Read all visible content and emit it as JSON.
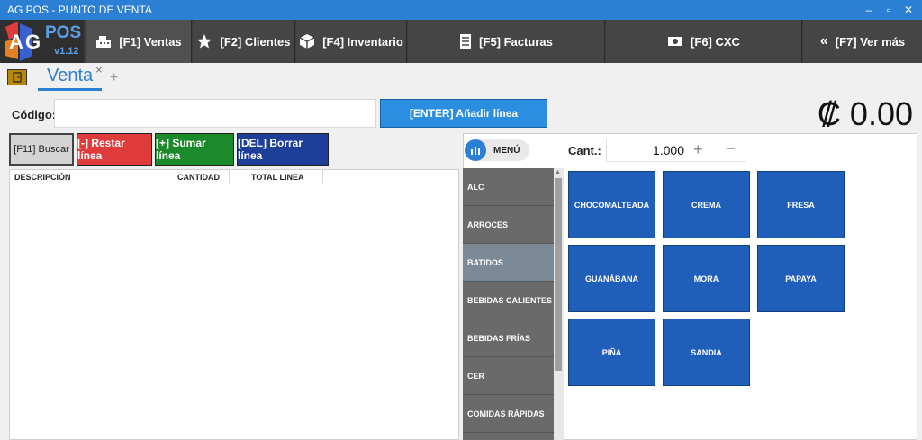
{
  "window": {
    "title": "AG POS - PUNTO DE VENTA",
    "controls": [
      "–",
      "▫",
      "✕"
    ]
  },
  "logo": {
    "name": "POS",
    "version": "v1.12"
  },
  "nav": [
    {
      "label": "[F1] Ventas",
      "icon": "cash-register-icon"
    },
    {
      "label": "[F2] Clientes",
      "icon": "star-icon"
    },
    {
      "label": "[F4] Inventario",
      "icon": "box-icon"
    },
    {
      "label": "[F5] Facturas",
      "icon": "invoice-icon"
    },
    {
      "label": "[F6] CXC",
      "icon": "money-icon"
    },
    {
      "label": "[F7] Ver más",
      "icon": "double-chevron-left-icon"
    }
  ],
  "tabs": {
    "active": "Venta",
    "close": "×",
    "add": "+"
  },
  "code": {
    "label": "Código:",
    "value": "",
    "placeholder": "",
    "add_button": "[ENTER] Añadir línea"
  },
  "total": "₡ 0.00",
  "actions": {
    "search": "[F11] Buscar",
    "subtract": "[-] Restar línea",
    "add": "[+] Sumar línea",
    "delete": "[DEL] Borrar línea"
  },
  "table": {
    "columns": [
      "DESCRIPCIÓN",
      "CANTIDAD",
      "TOTAL LINEA"
    ],
    "rows": []
  },
  "menu": {
    "label": "MENÚ"
  },
  "quantity": {
    "label": "Cant.:",
    "value": "1.000",
    "plus": "+",
    "minus": "−"
  },
  "categories": [
    "ALC",
    "ARROCES",
    "BATIDOS",
    "BEBIDAS CALIENTES",
    "BEBIDAS FRÍAS",
    "CER",
    "COMIDAS RÁPIDAS"
  ],
  "active_category": "BATIDOS",
  "products": [
    "CHOCOMALTEADA",
    "CREMA",
    "FRESA",
    "GUANÁBANA",
    "MORA",
    "PAPAYA",
    "PIÑA",
    "SANDIA"
  ],
  "colors": {
    "accent": "#2b7fd4",
    "danger": "#e03b3b",
    "success": "#1c8a2a",
    "dark_blue": "#1d3f99",
    "product": "#1f5fba"
  }
}
